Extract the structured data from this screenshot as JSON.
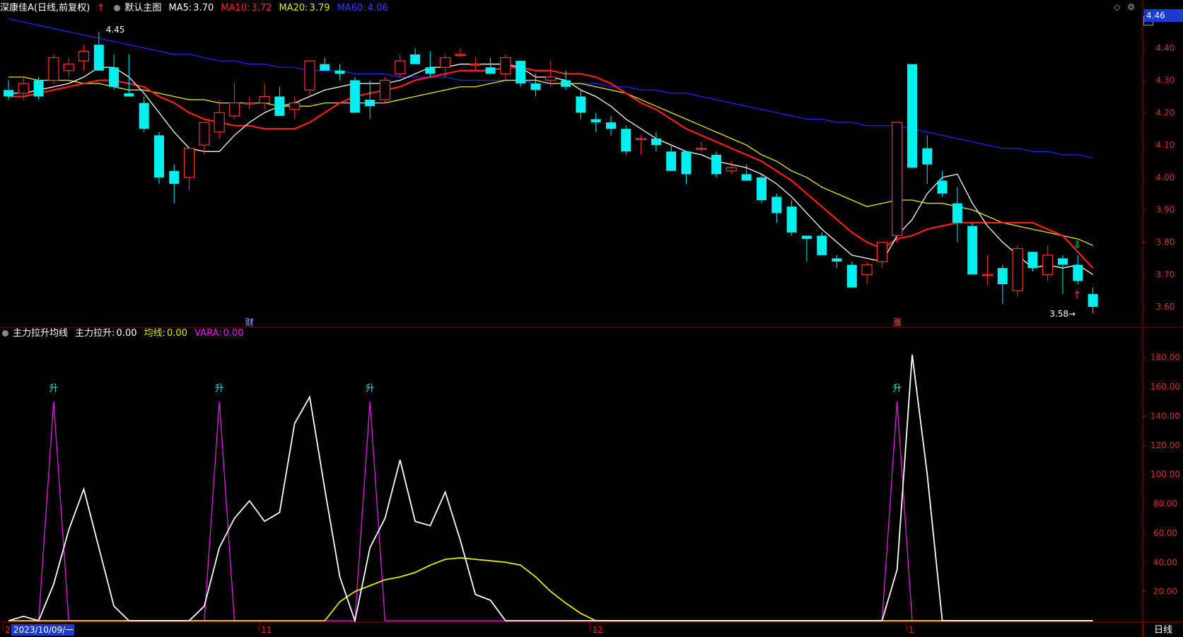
{
  "header": {
    "stock_name": "深康佳A",
    "period": "(日线,前复权)",
    "chart_name": "默认主图",
    "ma5_label": "MA5:",
    "ma5": "3.70",
    "ma10_label": "MA10:",
    "ma10": "3.72",
    "ma20_label": "MA20:",
    "ma20": "3.79",
    "ma60_label": "MA60:",
    "ma60": "4.06"
  },
  "sub_header": {
    "indicator": "主力拉升均线",
    "s1_label": "主力拉升:",
    "s1": "0.00",
    "s2_label": "均线:",
    "s2": "0.00",
    "s3_label": "VARA:",
    "s3": "0.00"
  },
  "icons": [
    "circle-dot-icon",
    "arrow-up-icon",
    "diamond-icon",
    "settings-icon",
    "scale-box-icon"
  ],
  "colors": {
    "up": "#ff3030",
    "down": "#00f0f0",
    "ma5": "#ffffff",
    "ma10": "#ff2020",
    "ma20": "#e8e800",
    "ma60": "#2020ff",
    "grid": "#8a0000",
    "vara": "#e020e0"
  },
  "footer": {
    "date": "2023/10/09/一",
    "period_tab": "日线"
  },
  "current_price": "4.46",
  "chart_data": [
    {
      "type": "candlestick",
      "title": "深康佳A (日线,前复权)",
      "ylim": [
        3.55,
        4.5
      ],
      "yticks": [
        "4.40",
        "4.30",
        "4.20",
        "4.10",
        "4.00",
        "3.90",
        "3.80",
        "3.70",
        "3.60"
      ],
      "xticks": [
        {
          "index": 0,
          "label": "2"
        },
        {
          "index": 17,
          "label": "11"
        },
        {
          "index": 39,
          "label": "12"
        },
        {
          "index": 60,
          "label": "1"
        }
      ],
      "annotations": [
        {
          "index": 6,
          "text": "4.45",
          "type": "high"
        },
        {
          "index": 71,
          "text": "3.58",
          "type": "low"
        },
        {
          "index": 16,
          "text": "财",
          "type": "event"
        },
        {
          "index": 59,
          "text": "涨",
          "type": "event"
        }
      ],
      "ohlc": [
        [
          4.27,
          4.3,
          4.24,
          4.25
        ],
        [
          4.26,
          4.31,
          4.24,
          4.29
        ],
        [
          4.3,
          4.31,
          4.24,
          4.25
        ],
        [
          4.3,
          4.38,
          4.29,
          4.37
        ],
        [
          4.33,
          4.37,
          4.31,
          4.35
        ],
        [
          4.36,
          4.41,
          4.33,
          4.39
        ],
        [
          4.41,
          4.45,
          4.33,
          4.33
        ],
        [
          4.34,
          4.38,
          4.27,
          4.28
        ],
        [
          4.26,
          4.38,
          4.25,
          4.25
        ],
        [
          4.23,
          4.25,
          4.14,
          4.15
        ],
        [
          4.13,
          4.14,
          3.98,
          4.0
        ],
        [
          4.02,
          4.04,
          3.92,
          3.98
        ],
        [
          4.0,
          4.09,
          3.96,
          4.09
        ],
        [
          4.1,
          4.17,
          4.07,
          4.17
        ],
        [
          4.14,
          4.24,
          4.12,
          4.2
        ],
        [
          4.19,
          4.29,
          4.18,
          4.23
        ],
        [
          4.23,
          4.25,
          4.21,
          4.23
        ],
        [
          4.23,
          4.29,
          4.21,
          4.25
        ],
        [
          4.25,
          4.28,
          4.19,
          4.19
        ],
        [
          4.21,
          4.25,
          4.18,
          4.23
        ],
        [
          4.27,
          4.36,
          4.25,
          4.36
        ],
        [
          4.35,
          4.37,
          4.33,
          4.33
        ],
        [
          4.33,
          4.35,
          4.3,
          4.32
        ],
        [
          4.3,
          4.31,
          4.2,
          4.2
        ],
        [
          4.24,
          4.3,
          4.18,
          4.22
        ],
        [
          4.24,
          4.31,
          4.23,
          4.3
        ],
        [
          4.32,
          4.38,
          4.31,
          4.36
        ],
        [
          4.38,
          4.4,
          4.35,
          4.35
        ],
        [
          4.34,
          4.39,
          4.31,
          4.32
        ],
        [
          4.34,
          4.38,
          4.31,
          4.37
        ],
        [
          4.38,
          4.4,
          4.37,
          4.38
        ],
        [
          4.35,
          4.37,
          4.33,
          4.35
        ],
        [
          4.34,
          4.37,
          4.32,
          4.32
        ],
        [
          4.32,
          4.38,
          4.3,
          4.37
        ],
        [
          4.36,
          4.36,
          4.28,
          4.29
        ],
        [
          4.29,
          4.32,
          4.25,
          4.27
        ],
        [
          4.3,
          4.36,
          4.28,
          4.31
        ],
        [
          4.3,
          4.33,
          4.27,
          4.28
        ],
        [
          4.25,
          4.27,
          4.18,
          4.2
        ],
        [
          4.18,
          4.2,
          4.14,
          4.17
        ],
        [
          4.17,
          4.19,
          4.13,
          4.15
        ],
        [
          4.15,
          4.16,
          4.07,
          4.08
        ],
        [
          4.12,
          4.13,
          4.07,
          4.12
        ],
        [
          4.12,
          4.14,
          4.08,
          4.1
        ],
        [
          4.08,
          4.1,
          4.02,
          4.02
        ],
        [
          4.08,
          4.08,
          3.98,
          4.01
        ],
        [
          4.09,
          4.11,
          4.08,
          4.09
        ],
        [
          4.07,
          4.08,
          4.0,
          4.01
        ],
        [
          4.02,
          4.05,
          4.01,
          4.03
        ],
        [
          4.01,
          4.04,
          3.99,
          3.99
        ],
        [
          4.0,
          4.01,
          3.92,
          3.93
        ],
        [
          3.94,
          3.95,
          3.86,
          3.89
        ],
        [
          3.91,
          3.93,
          3.82,
          3.83
        ],
        [
          3.82,
          3.82,
          3.74,
          3.81
        ],
        [
          3.82,
          3.83,
          3.76,
          3.76
        ],
        [
          3.75,
          3.76,
          3.72,
          3.74
        ],
        [
          3.73,
          3.74,
          3.66,
          3.66
        ],
        [
          3.7,
          3.74,
          3.67,
          3.73
        ],
        [
          3.74,
          3.8,
          3.72,
          3.8
        ],
        [
          3.82,
          4.17,
          3.8,
          4.17
        ],
        [
          4.35,
          4.35,
          4.03,
          4.03
        ],
        [
          4.09,
          4.13,
          3.98,
          4.04
        ],
        [
          3.99,
          4.02,
          3.94,
          3.95
        ],
        [
          3.92,
          3.97,
          3.8,
          3.86
        ],
        [
          3.85,
          3.86,
          3.7,
          3.7
        ],
        [
          3.7,
          3.76,
          3.67,
          3.7
        ],
        [
          3.72,
          3.73,
          3.61,
          3.67
        ],
        [
          3.65,
          3.79,
          3.63,
          3.78
        ],
        [
          3.77,
          3.77,
          3.71,
          3.72
        ],
        [
          3.7,
          3.79,
          3.68,
          3.76
        ],
        [
          3.75,
          3.76,
          3.64,
          3.73
        ],
        [
          3.73,
          3.76,
          3.67,
          3.68
        ],
        [
          3.64,
          3.66,
          3.58,
          3.6
        ]
      ],
      "ma5": [
        4.26,
        4.26,
        4.27,
        4.28,
        4.29,
        4.31,
        4.34,
        4.34,
        4.31,
        4.26,
        4.2,
        4.14,
        4.09,
        4.08,
        4.08,
        4.13,
        4.17,
        4.2,
        4.22,
        4.23,
        4.25,
        4.27,
        4.28,
        4.29,
        4.29,
        4.29,
        4.3,
        4.32,
        4.34,
        4.34,
        4.35,
        4.35,
        4.35,
        4.35,
        4.34,
        4.31,
        4.31,
        4.3,
        4.27,
        4.25,
        4.22,
        4.18,
        4.15,
        4.12,
        4.1,
        4.08,
        4.07,
        4.05,
        4.04,
        4.03,
        4.01,
        3.98,
        3.94,
        3.89,
        3.84,
        3.8,
        3.76,
        3.75,
        3.74,
        3.82,
        3.87,
        3.95,
        4.0,
        4.01,
        3.92,
        3.85,
        3.8,
        3.76,
        3.72,
        3.73,
        3.72,
        3.73,
        3.7
      ],
      "ma10": [
        4.25,
        4.25,
        4.26,
        4.27,
        4.28,
        4.29,
        4.3,
        4.3,
        4.29,
        4.28,
        4.25,
        4.23,
        4.2,
        4.18,
        4.17,
        4.16,
        4.16,
        4.15,
        4.15,
        4.15,
        4.17,
        4.2,
        4.23,
        4.25,
        4.26,
        4.27,
        4.28,
        4.3,
        4.31,
        4.32,
        4.33,
        4.33,
        4.33,
        4.34,
        4.34,
        4.33,
        4.33,
        4.32,
        4.32,
        4.31,
        4.29,
        4.26,
        4.23,
        4.21,
        4.18,
        4.15,
        4.13,
        4.11,
        4.09,
        4.07,
        4.05,
        4.02,
        3.99,
        3.95,
        3.91,
        3.87,
        3.83,
        3.8,
        3.78,
        3.81,
        3.82,
        3.84,
        3.85,
        3.86,
        3.86,
        3.86,
        3.86,
        3.86,
        3.86,
        3.84,
        3.82,
        3.77,
        3.72
      ],
      "ma20": [
        4.31,
        4.31,
        4.3,
        4.3,
        4.3,
        4.29,
        4.29,
        4.28,
        4.27,
        4.27,
        4.26,
        4.25,
        4.24,
        4.24,
        4.23,
        4.23,
        4.23,
        4.23,
        4.22,
        4.22,
        4.22,
        4.23,
        4.23,
        4.23,
        4.23,
        4.23,
        4.24,
        4.25,
        4.26,
        4.27,
        4.28,
        4.28,
        4.29,
        4.3,
        4.3,
        4.3,
        4.29,
        4.29,
        4.29,
        4.28,
        4.27,
        4.26,
        4.24,
        4.22,
        4.2,
        4.18,
        4.16,
        4.14,
        4.12,
        4.1,
        4.07,
        4.05,
        4.02,
        4.0,
        3.97,
        3.95,
        3.93,
        3.91,
        3.92,
        3.93,
        3.93,
        3.92,
        3.92,
        3.91,
        3.9,
        3.88,
        3.86,
        3.85,
        3.84,
        3.83,
        3.82,
        3.81,
        3.79
      ],
      "ma60": [
        4.49,
        4.48,
        4.47,
        4.46,
        4.45,
        4.44,
        4.43,
        4.42,
        4.41,
        4.4,
        4.39,
        4.38,
        4.38,
        4.37,
        4.36,
        4.36,
        4.35,
        4.35,
        4.34,
        4.34,
        4.33,
        4.33,
        4.33,
        4.32,
        4.32,
        4.32,
        4.31,
        4.31,
        4.31,
        4.31,
        4.3,
        4.3,
        4.3,
        4.3,
        4.3,
        4.29,
        4.29,
        4.29,
        4.29,
        4.29,
        4.28,
        4.28,
        4.27,
        4.27,
        4.26,
        4.26,
        4.25,
        4.24,
        4.23,
        4.22,
        4.21,
        4.2,
        4.19,
        4.18,
        4.18,
        4.17,
        4.17,
        4.16,
        4.16,
        4.16,
        4.15,
        4.14,
        4.13,
        4.12,
        4.11,
        4.1,
        4.09,
        4.09,
        4.08,
        4.08,
        4.07,
        4.07,
        4.06
      ]
    },
    {
      "type": "line",
      "title": "主力拉升均线",
      "ylim": [
        0,
        190
      ],
      "yticks": [
        "180.00",
        "160.00",
        "140.00",
        "120.00",
        "100.00",
        "80.00",
        "60.00",
        "40.00",
        "20.00"
      ],
      "signal_label": "升",
      "series": [
        {
          "name": "主力拉升",
          "values": [
            0,
            3,
            0,
            25,
            62,
            90,
            50,
            10,
            0,
            0,
            0,
            0,
            0,
            10,
            50,
            70,
            82,
            68,
            74,
            135,
            153,
            90,
            30,
            0,
            50,
            70,
            110,
            68,
            65,
            88,
            55,
            18,
            14,
            0,
            0,
            0,
            0,
            0,
            0,
            0,
            0,
            0,
            0,
            0,
            0,
            0,
            0,
            0,
            0,
            0,
            0,
            0,
            0,
            0,
            0,
            0,
            0,
            0,
            0,
            35,
            182,
            100,
            0,
            0,
            0,
            0,
            0,
            0,
            0,
            0,
            0,
            0,
            0
          ]
        },
        {
          "name": "均线",
          "values": [
            0,
            0,
            0,
            0,
            0,
            0,
            0,
            0,
            0,
            0,
            0,
            0,
            0,
            0,
            0,
            0,
            0,
            0,
            0,
            0,
            0,
            0,
            13,
            20,
            24,
            28,
            30,
            33,
            38,
            42,
            43,
            42,
            41,
            40,
            38,
            30,
            20,
            12,
            5,
            0,
            0,
            0,
            0,
            0,
            0,
            0,
            0,
            0,
            0,
            0,
            0,
            0,
            0,
            0,
            0,
            0,
            0,
            0,
            0,
            0,
            0,
            0,
            0,
            0,
            0,
            0,
            0,
            0,
            0,
            0,
            0,
            0,
            0
          ]
        },
        {
          "name": "VARA",
          "values": [
            0,
            0,
            0,
            150,
            0,
            0,
            0,
            0,
            0,
            0,
            0,
            0,
            0,
            0,
            150,
            0,
            0,
            0,
            0,
            0,
            0,
            0,
            0,
            0,
            150,
            0,
            0,
            0,
            0,
            0,
            0,
            0,
            0,
            0,
            0,
            0,
            0,
            0,
            0,
            0,
            0,
            0,
            0,
            0,
            0,
            0,
            0,
            0,
            0,
            0,
            0,
            0,
            0,
            0,
            0,
            0,
            0,
            0,
            0,
            150,
            0,
            0,
            0,
            0,
            0,
            0,
            0,
            0,
            0,
            0,
            0,
            0,
            0
          ]
        }
      ]
    }
  ]
}
